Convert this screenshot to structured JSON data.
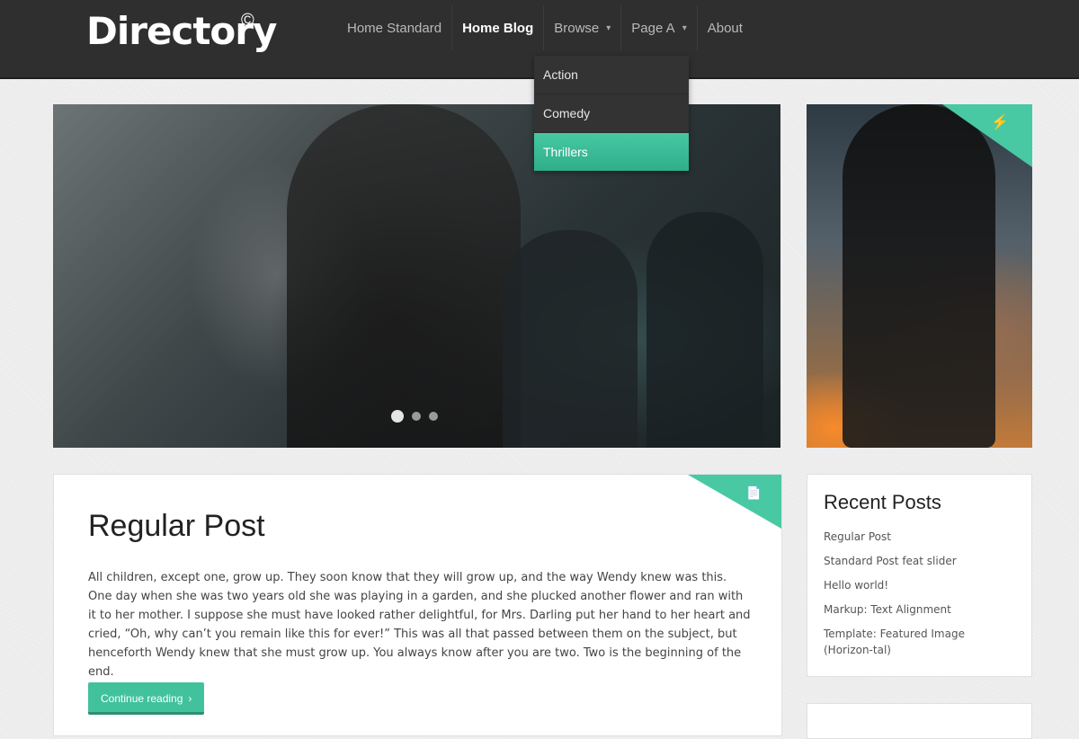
{
  "header": {
    "logo": "Directory",
    "logo_mark": "©"
  },
  "nav": {
    "items": [
      {
        "label": "Home Standard"
      },
      {
        "label": "Home Blog"
      },
      {
        "label": "Browse"
      },
      {
        "label": "Page A"
      },
      {
        "label": "About"
      }
    ],
    "active": "Home Blog"
  },
  "dropdown": {
    "items": [
      {
        "label": "Action"
      },
      {
        "label": "Comedy"
      },
      {
        "label": "Thrillers"
      }
    ],
    "active": "Thrillers"
  },
  "slider": {
    "dot_count": 3,
    "active_dot": 1
  },
  "post": {
    "title": "Regular Post",
    "body": "All children, except one, grow up. They soon know that they will grow up, and the way Wendy knew was this. One day when she was two years old she was playing in a garden, and she plucked another flower and ran with it to her mother. I suppose she must have looked rather delightful, for Mrs. Darling put her hand to her heart and cried, “Oh, why can’t you remain like this for ever!” This was all that passed between them on the subject, but henceforth Wendy knew that she must grow up. You always know after you are two. Two is the beginning of the end.",
    "button_label": "Continue reading",
    "type_icon": "document-icon"
  },
  "side_image": {
    "type_icon": "lightning-icon"
  },
  "recent_posts": {
    "title": "Recent Posts",
    "items": [
      "Regular Post",
      "Standard Post feat slider",
      "Hello world!",
      "Markup: Text Alignment",
      "Template: Featured Image (Horizon-tal)"
    ]
  },
  "colors": {
    "accent": "#41c29d",
    "header_bg": "#2f2f2f"
  }
}
